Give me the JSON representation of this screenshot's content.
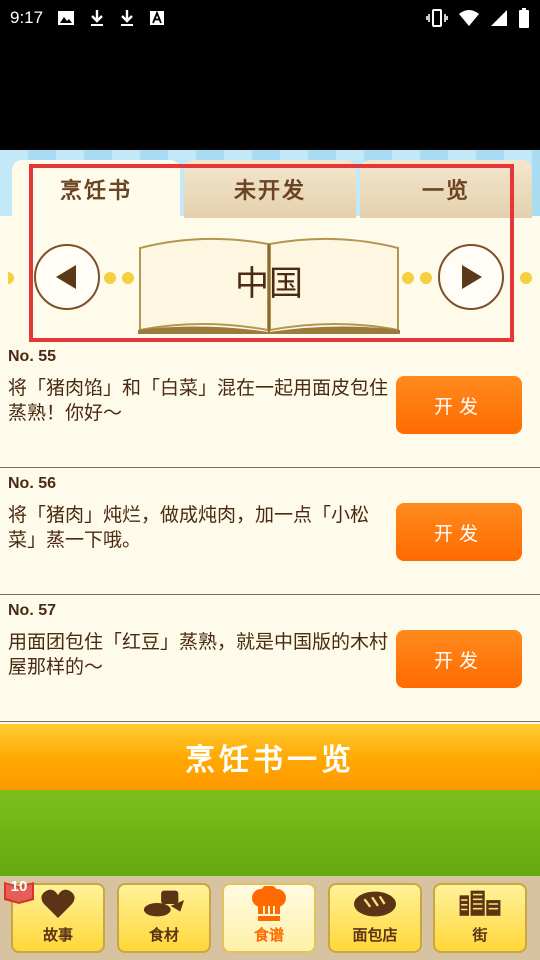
{
  "status_bar": {
    "time": "9:17",
    "left_icons": [
      "image-icon",
      "download-icon",
      "download-icon",
      "font-a-icon"
    ],
    "right_icons": [
      "vibrate-icon",
      "wifi-icon",
      "signal-icon",
      "battery-icon"
    ]
  },
  "tabs": [
    {
      "label": "烹饪书",
      "active": true
    },
    {
      "label": "未开发",
      "active": false
    },
    {
      "label": "一览",
      "active": false
    }
  ],
  "book": {
    "title": "中国"
  },
  "recipes": [
    {
      "no": "No. 55",
      "desc": "将「猪肉馅」和「白菜」混在一起用面皮包住蒸熟！你好～",
      "button": "开发"
    },
    {
      "no": "No. 56",
      "desc": "将「猪肉」炖烂，做成炖肉，加一点「小松菜」蒸一下哦。",
      "button": "开发"
    },
    {
      "no": "No. 57",
      "desc": "用面团包住「红豆」蒸熟，就是中国版的木村屋那样的～",
      "button": "开发"
    }
  ],
  "book_list_button": "烹饪书一览",
  "badge": "10",
  "bottom_nav": [
    {
      "label": "故事",
      "icon": "heart-icon"
    },
    {
      "label": "食材",
      "icon": "ingredients-icon"
    },
    {
      "label": "食谱",
      "icon": "chef-hat-icon",
      "active": true
    },
    {
      "label": "面包店",
      "icon": "bread-icon"
    },
    {
      "label": "街",
      "icon": "buildings-icon"
    }
  ],
  "colors": {
    "accent": "#ff7a10",
    "highlight": "#e53638",
    "brown": "#4a2a12",
    "grass": "#6fb214"
  }
}
